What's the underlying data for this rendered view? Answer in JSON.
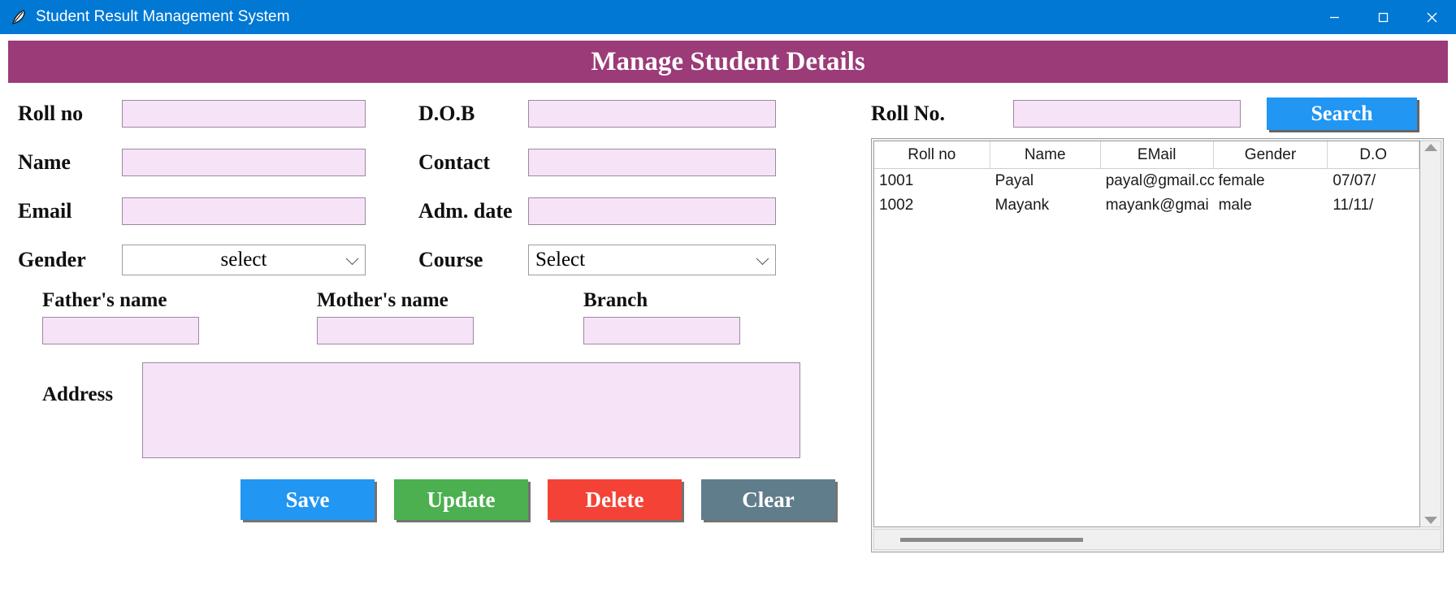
{
  "window": {
    "title": "Student Result Management System",
    "icon": "feather-icon",
    "controls": {
      "minimize": "–",
      "maximize": "□",
      "close": "✕"
    },
    "titlebar_color": "#0078D4"
  },
  "header": {
    "title": "Manage Student Details",
    "banner_color": "#9B3B78"
  },
  "form": {
    "fields": {
      "roll_no": {
        "label": "Roll no",
        "value": ""
      },
      "name": {
        "label": "Name",
        "value": ""
      },
      "email": {
        "label": "Email",
        "value": ""
      },
      "gender": {
        "label": "Gender",
        "value": "select"
      },
      "dob": {
        "label": "D.O.B",
        "value": ""
      },
      "contact": {
        "label": "Contact",
        "value": ""
      },
      "adm_date": {
        "label": "Adm. date",
        "value": ""
      },
      "course": {
        "label": "Course",
        "value": "Select"
      },
      "father": {
        "label": "Father's name",
        "value": ""
      },
      "mother": {
        "label": "Mother's name",
        "value": ""
      },
      "branch": {
        "label": "Branch",
        "value": ""
      },
      "address": {
        "label": "Address",
        "value": ""
      }
    },
    "buttons": {
      "save": {
        "label": "Save",
        "color": "#2196F3"
      },
      "update": {
        "label": "Update",
        "color": "#4CAF50"
      },
      "delete": {
        "label": "Delete",
        "color": "#F44336"
      },
      "clear": {
        "label": "Clear",
        "color": "#607D8B"
      }
    }
  },
  "search": {
    "label": "Roll No.",
    "value": "",
    "button_label": "Search",
    "button_color": "#2196F3"
  },
  "table": {
    "columns": [
      "Roll no",
      "Name",
      "EMail",
      "Gender",
      "D.O"
    ],
    "rows": [
      [
        "1001",
        "Payal",
        "payal@gmail.cc",
        "female",
        "07/07/"
      ],
      [
        "1002",
        "Mayank",
        "mayank@gmai",
        "male",
        "11/11/"
      ]
    ]
  }
}
